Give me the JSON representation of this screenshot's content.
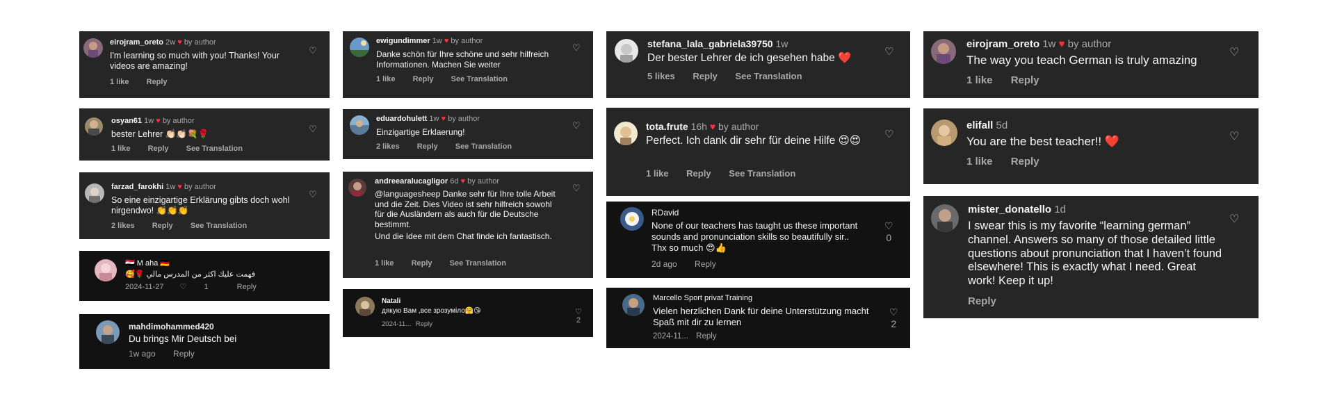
{
  "comments": [
    {
      "user": "eirojram_oreto",
      "time": "2w",
      "heart": "♥",
      "author": "by author",
      "text": "I'm learning so much with you! Thanks! Your videos are amazing!",
      "likes": "1 like",
      "reply": "Reply",
      "translation": ""
    },
    {
      "user": "osyan61",
      "time": "1w",
      "heart": "♥",
      "author": "by author",
      "text": "bester Lehrer 👏🏻👏🏻💐🌹",
      "likes": "1 like",
      "reply": "Reply",
      "translation": "See Translation"
    },
    {
      "user": "farzad_farokhi",
      "time": "1w",
      "heart": "♥",
      "author": "by author",
      "text": "So eine einzigartige Erklärung gibts doch wohl nirgendwo! 👏👏👏",
      "likes": "2 likes",
      "reply": "Reply",
      "translation": "See Translation"
    },
    {
      "user": "🇮🇶 M aha 🇩🇪",
      "date": "2024-11-27",
      "text": "فهمت عليك اكثر من المدرس مالي 🌹🥰",
      "like_count": "1",
      "reply": "Reply"
    },
    {
      "user": "mahdimohammed420",
      "time": "1w ago",
      "text": "Du brings Mir Deutsch bei",
      "reply": "Reply"
    },
    {
      "user": "ewigundimmer",
      "time": "1w",
      "heart": "♥",
      "author": "by author",
      "text": "Danke schön für Ihre schöne und sehr hilfreich Informationen. Machen Sie weiter",
      "likes": "1 like",
      "reply": "Reply",
      "translation": "See Translation"
    },
    {
      "user": "eduardohulett",
      "time": "1w",
      "heart": "♥",
      "author": "by author",
      "text": "Einzigartige Erklaerung!",
      "likes": "2 likes",
      "reply": "Reply",
      "translation": "See Translation"
    },
    {
      "user": "andreearalucagligor",
      "time": "6d",
      "heart": "♥",
      "author": "by author",
      "text": "@languagesheep Danke sehr für Ihre tolle Arbeit und die Zeit. Dies Video ist sehr hilfreich sowohl für die Ausländern als auch für die Deutsche bestimmt.",
      "text2": "Und die Idee mit dem Chat finde ich fantastisch.",
      "likes": "1 like",
      "reply": "Reply",
      "translation": "See Translation"
    },
    {
      "user": "Natali",
      "date": "2024-11...",
      "text": "дякую Вам ,все зрозуміло🤗😘",
      "like_count": "2",
      "reply": "Reply"
    },
    {
      "user": "stefana_lala_gabriela39750",
      "time": "1w",
      "text": "Der bester Lehrer de ich gesehen habe ❤️",
      "likes": "5 likes",
      "reply": "Reply",
      "translation": "See Translation"
    },
    {
      "user": "tota.frute",
      "time": "16h",
      "heart": "♥",
      "author": "by author",
      "text": "Perfect. Ich dank dir sehr für deine Hilfe 😍😍",
      "likes": "1 like",
      "reply": "Reply",
      "translation": "See Translation"
    },
    {
      "user": "RDavid",
      "date": "2d ago",
      "text": "None of our teachers has taught us these important sounds and pronunciation skills so beautifully sir.. Thx so much 😍👍",
      "like_count": "0",
      "reply": "Reply"
    },
    {
      "user": "Marcello Sport privat Training",
      "date": "2024-11...",
      "text": "Vielen herzlichen Dank für deine Unterstützung macht Spaß mit dir zu lernen",
      "like_count": "2",
      "reply": "Reply"
    },
    {
      "user": "eirojram_oreto",
      "time": "1w",
      "heart": "♥",
      "author": "by author",
      "text": "The way you teach German is truly amazing",
      "likes": "1 like",
      "reply": "Reply",
      "translation": ""
    },
    {
      "user": "elifall",
      "time": "5d",
      "text": "You are the best teacher!! ❤️",
      "likes": "1 like",
      "reply": "Reply",
      "translation": ""
    },
    {
      "user": "mister_donatello",
      "time": "1d",
      "text": "I swear this is my favorite “learning german” channel. Answers so many of those detailed little questions about pronunciation that I haven’t found elsewhere! This is exactly what I need. Great work! Keep it up!",
      "reply": "Reply"
    }
  ],
  "icons": {
    "like": "heart-outline-icon"
  }
}
